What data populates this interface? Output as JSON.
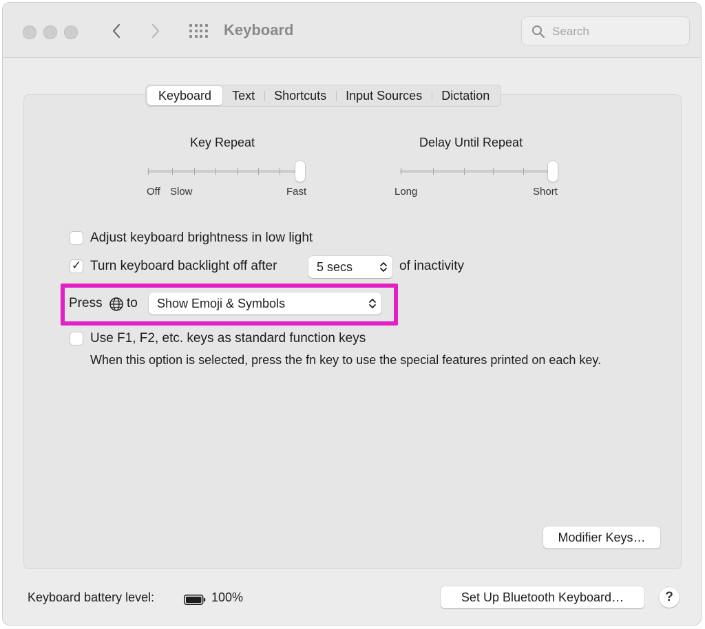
{
  "window": {
    "title": "Keyboard",
    "search_placeholder": "Search"
  },
  "tabs": [
    {
      "label": "Keyboard",
      "active": true
    },
    {
      "label": "Text",
      "active": false
    },
    {
      "label": "Shortcuts",
      "active": false
    },
    {
      "label": "Input Sources",
      "active": false
    },
    {
      "label": "Dictation",
      "active": false
    }
  ],
  "key_repeat": {
    "title": "Key Repeat",
    "labels": [
      "Off",
      "Slow",
      "Fast"
    ],
    "level": 1.0
  },
  "delay_until_repeat": {
    "title": "Delay Until Repeat",
    "labels": [
      "Long",
      "Short"
    ],
    "level": 1.0
  },
  "options": {
    "adjust_brightness": {
      "label": "Adjust keyboard brightness in low light",
      "checked": false
    },
    "backlight_off": {
      "label": "Turn keyboard backlight off after",
      "checked": true,
      "value": "5 secs",
      "suffix": "of inactivity"
    },
    "press_globe": {
      "prefix": "Press",
      "suffix": "to",
      "value": "Show Emoji & Symbols"
    },
    "function_keys": {
      "label": "Use F1, F2, etc. keys as standard function keys",
      "checked": false,
      "description": "When this option is selected, press the fn key to use the special features printed on each key."
    }
  },
  "buttons": {
    "modifier_keys": "Modifier Keys…",
    "setup_bluetooth": "Set Up Bluetooth Keyboard…",
    "help": "?"
  },
  "battery": {
    "label": "Keyboard battery level:",
    "value": "100%"
  },
  "colors": {
    "highlight": "#e41fc6"
  }
}
